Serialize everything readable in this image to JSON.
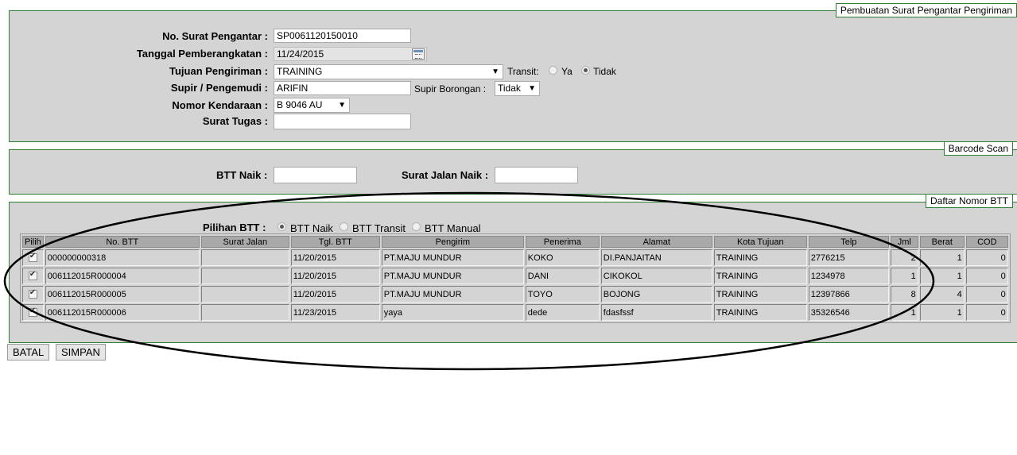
{
  "form": {
    "legend": "Pembuatan Surat Pengantar Pengiriman",
    "no_surat_label": "No. Surat Pengantar :",
    "no_surat_value": "SP0061120150010",
    "tanggal_label": "Tanggal Pemberangkatan :",
    "tanggal_value": "11/24/2015",
    "tujuan_label": "Tujuan Pengiriman :",
    "tujuan_value": "TRAINING",
    "transit_label": "Transit:",
    "transit_ya": "Ya",
    "transit_tidak": "Tidak",
    "transit_selected": "Tidak",
    "supir_label": "Supir / Pengemudi :",
    "supir_value": "ARIFIN",
    "supir_borongan_label": "Supir Borongan :",
    "supir_borongan_value": "Tidak",
    "kendaraan_label": "Nomor Kendaraan :",
    "kendaraan_value": "B 9046 AU",
    "surat_tugas_label": "Surat Tugas :",
    "surat_tugas_value": ""
  },
  "barcode": {
    "legend": "Barcode Scan",
    "btt_naik_label": "BTT Naik :",
    "btt_naik_value": "",
    "surat_jalan_label": "Surat Jalan Naik :",
    "surat_jalan_value": ""
  },
  "daftar": {
    "legend": "Daftar Nomor BTT",
    "pilihan_label": "Pilihan BTT :",
    "options": [
      "BTT Naik",
      "BTT Transit",
      "BTT Manual"
    ],
    "selected": "BTT Naik",
    "columns": [
      "Pilih",
      "No. BTT",
      "Surat Jalan",
      "Tgl. BTT",
      "Pengirim",
      "Penerima",
      "Alamat",
      "Kota Tujuan",
      "Telp",
      "Jml",
      "Berat",
      "COD"
    ],
    "rows": [
      {
        "checked": true,
        "no_btt": "000000000318",
        "surat_jalan": "",
        "tgl": "11/20/2015",
        "pengirim": "PT.MAJU MUNDUR",
        "penerima": "KOKO",
        "alamat": "DI.PANJAITAN",
        "kota": "TRAINING",
        "telp": "2776215",
        "jml": "2",
        "berat": "1",
        "cod": "0"
      },
      {
        "checked": true,
        "no_btt": "006112015R000004",
        "surat_jalan": "",
        "tgl": "11/20/2015",
        "pengirim": "PT.MAJU MUNDUR",
        "penerima": "DANI",
        "alamat": "CIKOKOL",
        "kota": "TRAINING",
        "telp": "1234978",
        "jml": "1",
        "berat": "1",
        "cod": "0"
      },
      {
        "checked": true,
        "no_btt": "006112015R000005",
        "surat_jalan": "",
        "tgl": "11/20/2015",
        "pengirim": "PT.MAJU MUNDUR",
        "penerima": "TOYO",
        "alamat": "BOJONG",
        "kota": "TRAINING",
        "telp": "12397866",
        "jml": "8",
        "berat": "4",
        "cod": "0"
      },
      {
        "checked": true,
        "no_btt": "006112015R000006",
        "surat_jalan": "",
        "tgl": "11/23/2015",
        "pengirim": "yaya",
        "penerima": "dede",
        "alamat": "fdasfssf",
        "kota": "TRAINING",
        "telp": "35326546",
        "jml": "1",
        "berat": "1",
        "cod": "0"
      }
    ]
  },
  "buttons": {
    "batal": "BATAL",
    "simpan": "SIMPAN"
  },
  "colors": {
    "panel_bg": "#d4d4d4",
    "border_green": "#2e7d32",
    "header_bg": "#a9a9a9"
  }
}
